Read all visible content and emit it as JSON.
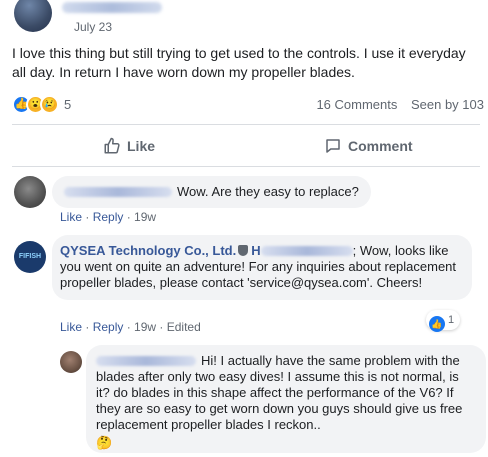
{
  "post": {
    "date": "July 23",
    "text": "I love this thing but still trying to get used to the controls. I use it everyday all day. In return I have worn down my propeller blades.",
    "reaction_count": "5",
    "comments_count": "16 Comments",
    "seen_by": "Seen by 103"
  },
  "actions": {
    "like_label": "Like",
    "comment_label": "Comment"
  },
  "comments": [
    {
      "text": "Wow. Are they easy to replace?",
      "like": "Like",
      "reply": "Reply",
      "time": "19w"
    },
    {
      "author": "QYSEA Technology Co., Ltd.",
      "avatar_text": "FIFISH",
      "mention_prefix": "H",
      "text_first": "; Wow, looks",
      "text_rest": "like you went on quite an adventure! For any inquiries about replacement propeller blades, please contact 'service@qysea.com'. Cheers!",
      "like": "Like",
      "reply": "Reply",
      "time": "19w",
      "edited": "Edited",
      "like_count": "1"
    },
    {
      "text_first": "Hi! I actually have the same problem with",
      "text_rest": "the blades after only two easy dives! I assume this is not normal, is it? do blades in this shape affect the performance of the V6? If they are so easy to get worn down you guys should give us free replacement propeller blades I reckon.."
    }
  ],
  "colors": {
    "accent": "#1877f2",
    "link": "#385898",
    "bubble": "#f2f3f5"
  }
}
